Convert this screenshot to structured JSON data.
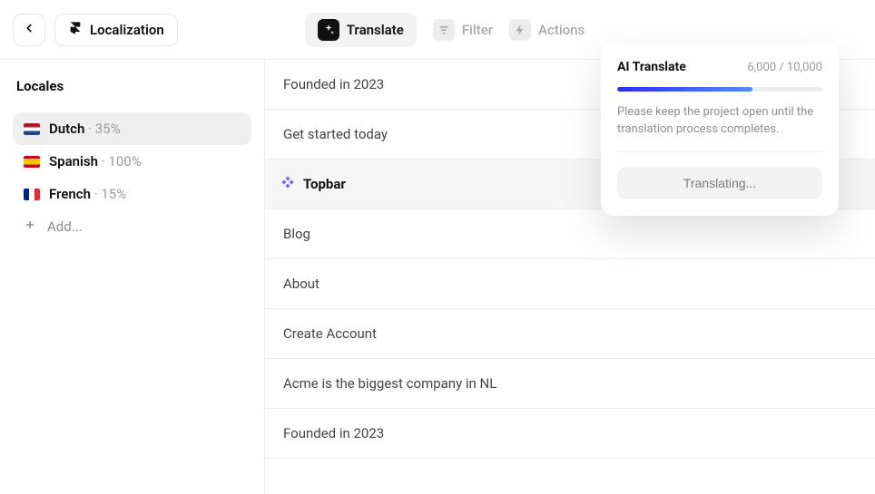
{
  "header": {
    "localization_label": "Localization",
    "translate_label": "Translate",
    "filter_label": "Filter",
    "actions_label": "Actions"
  },
  "sidebar": {
    "title": "Locales",
    "items": [
      {
        "name": "Dutch",
        "pct": "35%",
        "flag": "nl",
        "active": true
      },
      {
        "name": "Spanish",
        "pct": "100%",
        "flag": "es",
        "active": false
      },
      {
        "name": "French",
        "pct": "15%",
        "flag": "fr",
        "active": false
      }
    ],
    "add_label": "Add..."
  },
  "content": {
    "rows_top": [
      "Founded in 2023",
      "Get started today"
    ],
    "section_label": "Topbar",
    "rows_bottom": [
      "Blog",
      "About",
      "Create Account",
      "Acme is the biggest company in NL",
      "Founded in 2023"
    ]
  },
  "popover": {
    "title": "AI Translate",
    "counter": "6,000 / 10,000",
    "progress_pct": 66,
    "text": "Please keep the project open until the translation process completes.",
    "button_label": "Translating..."
  }
}
